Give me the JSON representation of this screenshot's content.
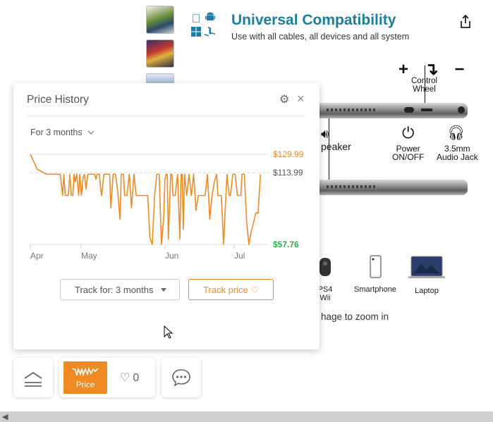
{
  "compat": {
    "title": "Universal Compatibility",
    "subtitle": "Use with all cables, all devices and all system",
    "os_icons": [
      "apple-icon",
      "android-icon",
      "windows-icon",
      "playstation-icon"
    ]
  },
  "controls": {
    "symbols": "+ ↴ −",
    "label": "Control\nWheel",
    "speaker": "peaker",
    "power": "Power\nON/OFF",
    "jack": "3.5mm\nAudio Jack"
  },
  "devices": [
    {
      "label": "PS4\nWii",
      "icon": "gamepad-icon"
    },
    {
      "label": "Smartphone",
      "icon": "smartphone-icon"
    },
    {
      "label": "Laptop",
      "icon": "laptop-icon"
    }
  ],
  "zoom_hint": "hage to zoom in",
  "price_history": {
    "title": "Price History",
    "range": "For 3 months",
    "track_for": "Track for: 3 months",
    "track_button": "Track price"
  },
  "toolbar": {
    "price_label": "Price",
    "likes": "0"
  },
  "colors": {
    "accent": "#f08a24",
    "low": "#2bb24c",
    "title": "#1a7f9c"
  },
  "chart_data": {
    "type": "line",
    "x_ticks": [
      "Apr",
      "May",
      "Jun",
      "Jul"
    ],
    "y_labels": {
      "high": "$129.99",
      "mid": "$113.99",
      "low": "$57.76"
    },
    "ylim": [
      57.76,
      129.99
    ],
    "grid": true,
    "x": [
      0,
      3,
      7,
      13,
      14,
      14.6,
      15.2,
      16.5,
      17.2,
      17.8,
      18.5,
      19,
      19.5,
      20.2,
      21,
      21.5,
      22.2,
      23,
      23.5,
      24.2,
      25,
      26,
      27.5,
      28,
      28.5,
      29,
      29.5,
      30,
      30.5,
      31,
      32,
      34,
      34.5,
      35,
      36,
      37,
      38,
      39,
      39.5,
      40,
      40.5,
      41,
      41.5,
      42,
      43,
      44,
      45,
      46,
      47,
      48,
      48.5,
      49,
      50,
      51,
      52,
      53,
      54,
      55,
      56,
      57,
      58,
      58.5,
      59,
      59.5,
      60,
      61,
      61.5,
      62,
      63,
      64,
      65,
      65.5,
      66,
      66.5,
      67,
      68,
      69,
      70,
      71,
      72,
      73,
      74,
      75,
      76,
      77,
      78,
      79,
      80,
      81,
      81.5,
      82,
      83,
      84,
      85,
      85.5,
      86,
      86.5,
      87,
      88,
      89,
      90,
      91,
      91.5,
      92,
      93,
      94,
      95,
      96,
      97,
      98,
      99,
      100,
      101,
      102,
      103
    ],
    "y": [
      129.99,
      118,
      114,
      114,
      97,
      114,
      97,
      97,
      114,
      97,
      97,
      114,
      108,
      114,
      97,
      114,
      97,
      112,
      114,
      102,
      114,
      114,
      114,
      114,
      110,
      114,
      114,
      114,
      104,
      97,
      114,
      114,
      114,
      87,
      114,
      114,
      100,
      78,
      114,
      114,
      114,
      97,
      97,
      97,
      114,
      87,
      114,
      97,
      97,
      97,
      97,
      97,
      97,
      97,
      63,
      57.76,
      97,
      114,
      114,
      57.76,
      80,
      110,
      114,
      114,
      62,
      114,
      114,
      97,
      97,
      114,
      62,
      114,
      114,
      70,
      114,
      97,
      114,
      97,
      114,
      85,
      97,
      97,
      97,
      97,
      114,
      78,
      97,
      108,
      114,
      97,
      97,
      97,
      57.76,
      97,
      114,
      104,
      97,
      97,
      114,
      114,
      97,
      97,
      97,
      114,
      114,
      77,
      57.76,
      68,
      75,
      83,
      83,
      114
    ]
  }
}
